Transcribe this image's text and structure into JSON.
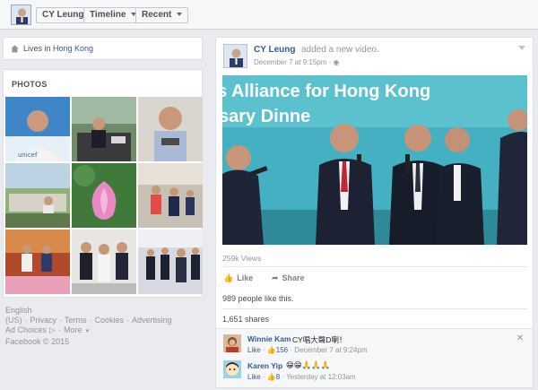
{
  "header": {
    "name": "CY Leung",
    "timeline_label": "Timeline",
    "recent_label": "Recent"
  },
  "intro": {
    "lives_prefix": "Lives in ",
    "lives_city": "Hong Kong"
  },
  "photos": {
    "title": "PHOTOS"
  },
  "footer": {
    "links": [
      "English (US)",
      "·",
      "Privacy",
      "·",
      "Terms",
      "·",
      "Cookies",
      "·",
      "Advertising"
    ],
    "ad_choices": "Ad Choices",
    "more": "More",
    "copyright": "Facebook © 2015"
  },
  "post": {
    "author": "CY Leung",
    "action": "added a new video.",
    "time": "December 7 at 9:15pm",
    "video_banner_line1": "s Alliance for Hong Kong",
    "video_banner_line2": "sary Dinne",
    "views": "259k Views",
    "like_label": "Like",
    "share_label": "Share",
    "likes_summary": "989 people like this.",
    "shares_summary": "1,651 shares"
  },
  "comments": [
    {
      "name": "Winnie Kam",
      "text": "CY唱大聲D喇！",
      "like": "Like",
      "like_count": "156",
      "time": "December 7 at 9:24pm"
    },
    {
      "name": "Karen Yip",
      "text": "😁😁🙏🙏🙏",
      "like": "Like",
      "like_count": "8",
      "time": "Yesterday at 12:03am"
    }
  ],
  "colors": {
    "link": "#365899",
    "background": "#e9ebee"
  }
}
